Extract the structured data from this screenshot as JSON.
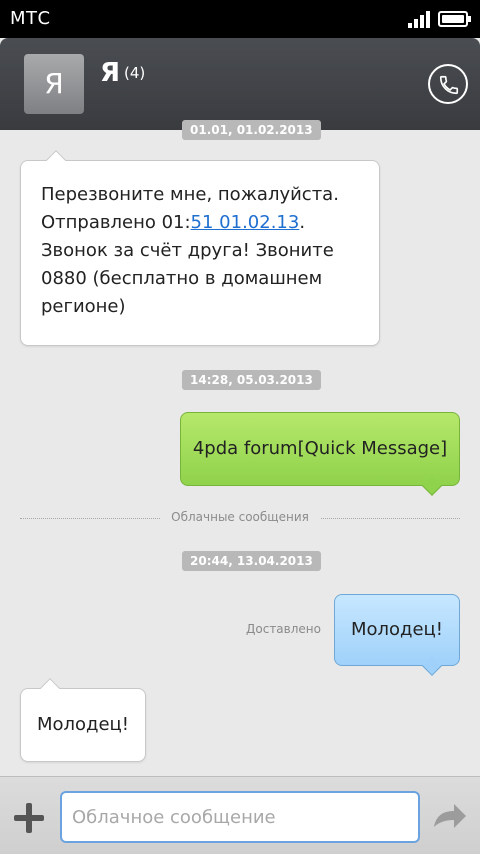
{
  "status_bar": {
    "carrier": "МТС"
  },
  "header": {
    "avatar_letter": "Я",
    "contact_name": "Я",
    "thread_count": "(4)"
  },
  "messages": {
    "partial_stamp": "01.01, 01.02.2013",
    "m1": {
      "line1": "Перезвоните мне, пожалуйста.",
      "line2_prefix": "Отправлено 01:",
      "line2_link": "51 01.02.13",
      "line2_suffix": ".",
      "line3": "Звонок за счёт друга! Звоните",
      "line4": "0880 (бесплатно в домашнем",
      "line5": "регионе)"
    },
    "stamp2": "14:28, 05.03.2013",
    "m2": "4pda forum[Quick Message]",
    "divider": "Облачные сообщения",
    "stamp3": "20:44, 13.04.2013",
    "delivered": "Доставлено",
    "m3": "Молодец!",
    "m4": "Молодец!"
  },
  "composer": {
    "placeholder": "Облачное сообщение",
    "value": ""
  },
  "icons": {
    "call": "phone-icon",
    "add": "plus-icon",
    "send": "send-arrow-icon"
  }
}
